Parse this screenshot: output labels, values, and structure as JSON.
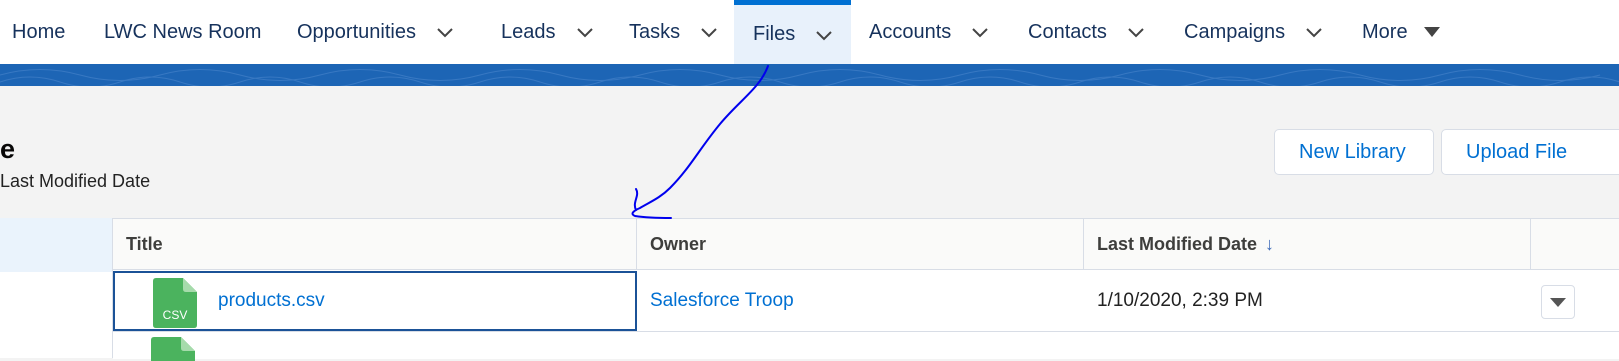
{
  "nav": {
    "items": [
      {
        "label": "Home"
      },
      {
        "label": "LWC News Room"
      },
      {
        "label": "Opportunities"
      },
      {
        "label": "Leads"
      },
      {
        "label": "Tasks"
      },
      {
        "label": "Files"
      },
      {
        "label": "Accounts"
      },
      {
        "label": "Contacts"
      },
      {
        "label": "Campaigns"
      },
      {
        "label": "More"
      }
    ],
    "active": "Files"
  },
  "page": {
    "title_fragment": "e",
    "subtitle_fragment": "Last Modified Date"
  },
  "buttons": {
    "new_library": "New Library",
    "upload_files": "Upload File"
  },
  "table": {
    "columns": [
      "Title",
      "Owner",
      "Last Modified Date"
    ],
    "sort_indicator": "↓",
    "rows": [
      {
        "file_type": "CSV",
        "title": "products.csv",
        "owner": "Salesforce Troop",
        "modified": "1/10/2020, 2:39 PM"
      }
    ]
  },
  "colors": {
    "accent": "#0070d2",
    "banner": "#1d65b5",
    "file_icon": "#4bb35e",
    "annotation": "#0000ee"
  },
  "icons": {
    "dropdown": "chevron-down-icon",
    "more": "caret-down-icon",
    "file": "csv-file-icon",
    "row_action": "caret-down-icon"
  }
}
